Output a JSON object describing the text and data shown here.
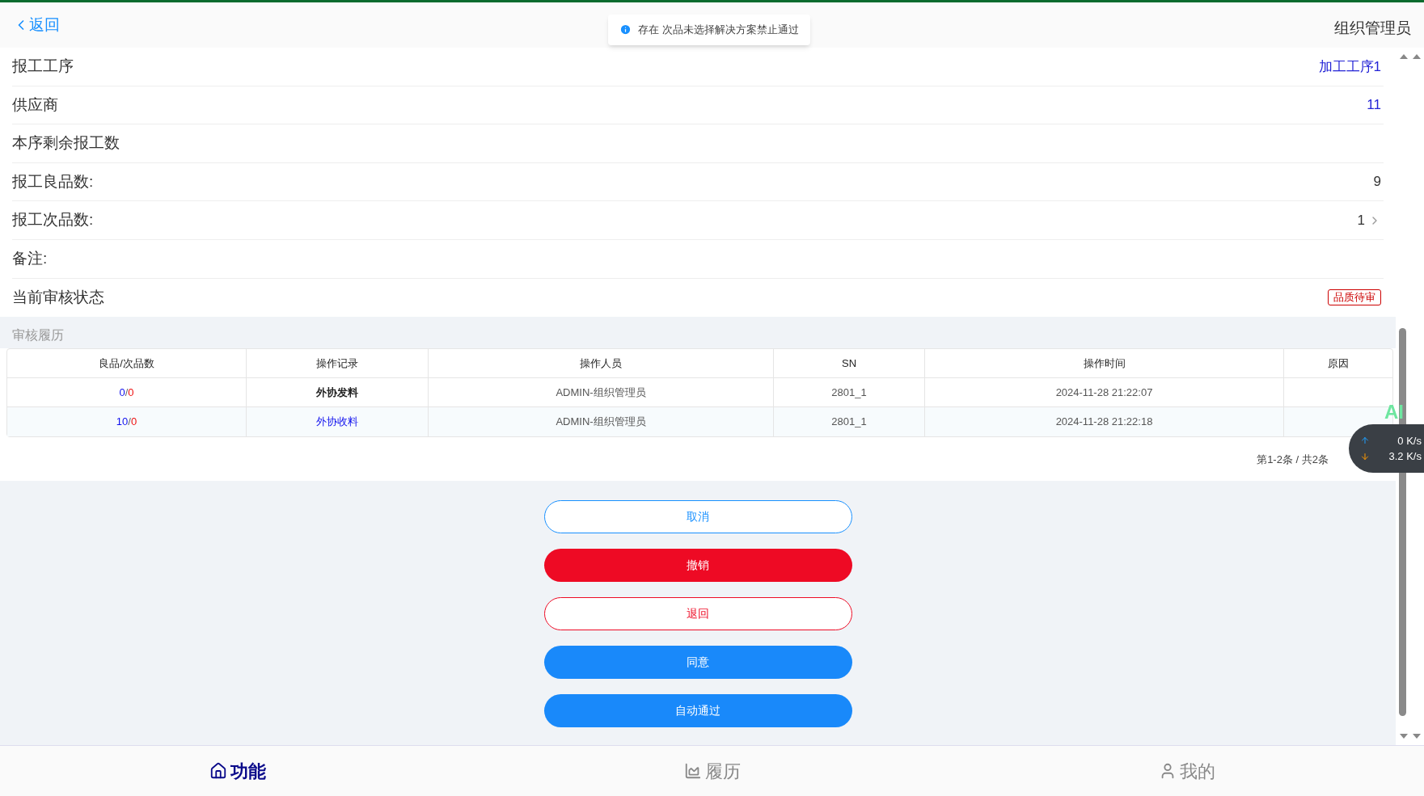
{
  "header": {
    "back": "返回",
    "toast": "存在 次品未选择解决方案禁止通过",
    "user": "组织管理员"
  },
  "fields": [
    {
      "label": "报工工序",
      "kind": "link",
      "value": "加工工序1"
    },
    {
      "label": "供应商",
      "kind": "link",
      "value": "11"
    },
    {
      "label": "本序剩余报工数"
    },
    {
      "label": "报工良品数:",
      "kind": "text",
      "value": "9"
    },
    {
      "label": "报工次品数:",
      "kind": "chevron",
      "value": "1"
    },
    {
      "label": "备注:"
    },
    {
      "label": "当前审核状态",
      "kind": "tag",
      "value": "品质待审"
    }
  ],
  "history": {
    "title": "审核履历",
    "columns": [
      "良品/次品数",
      "操作记录",
      "操作人员",
      "SN",
      "操作时间",
      "原因"
    ],
    "rows": [
      {
        "good": "0",
        "separator": "/",
        "bad": "0",
        "action": "外协发料",
        "action_link": false,
        "operator": "ADMIN-组织管理员",
        "sn": "2801_1",
        "time": "2024-11-28 21:22:07"
      },
      {
        "good": "10",
        "separator": "/",
        "bad": "0",
        "action": "外协收料",
        "action_link": true,
        "operator": "ADMIN-组织管理员",
        "sn": "2801_1",
        "time": "2024-11-28 21:22:18"
      }
    ],
    "pagination": "第1-2条 / 共2条"
  },
  "buttons": [
    {
      "label": "取消",
      "kind": "outline-blue"
    },
    {
      "label": "撤销",
      "kind": "solid-red"
    },
    {
      "label": "退回",
      "kind": "outline-red"
    },
    {
      "label": "同意",
      "kind": "solid-blue"
    },
    {
      "label": "自动通过",
      "kind": "solid-blue"
    }
  ],
  "net_widget": {
    "badge": "AI",
    "up": "0",
    "up_unit": "K/s",
    "down": "3.2",
    "down_unit": "K/s"
  },
  "tabs": [
    {
      "label": "功能",
      "selected": true
    },
    {
      "label": "履历",
      "selected": false
    },
    {
      "label": "我的",
      "selected": false
    }
  ]
}
